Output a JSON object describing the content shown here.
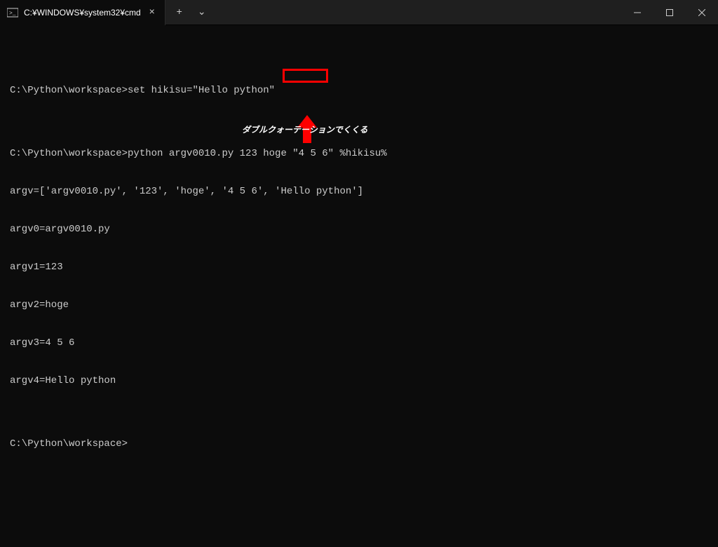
{
  "tab": {
    "title": "C:¥WINDOWS¥system32¥cmd",
    "close_glyph": "×",
    "new_glyph": "+",
    "dropdown_glyph": "⌄"
  },
  "terminal": {
    "lines": [
      "",
      "C:\\Python\\workspace>set hikisu=\"Hello python\"",
      "",
      "C:\\Python\\workspace>python argv0010.py 123 hoge \"4 5 6\" %hikisu%",
      "argv=['argv0010.py', '123', 'hoge', '4 5 6', 'Hello python']",
      "argv0=argv0010.py",
      "argv1=123",
      "argv2=hoge",
      "argv3=4 5 6",
      "argv4=Hello python",
      "",
      "C:\\Python\\workspace>"
    ]
  },
  "annotation": {
    "text": "ダブルクォーテーションでくくる",
    "highlight_target": "\"4 5 6\""
  }
}
